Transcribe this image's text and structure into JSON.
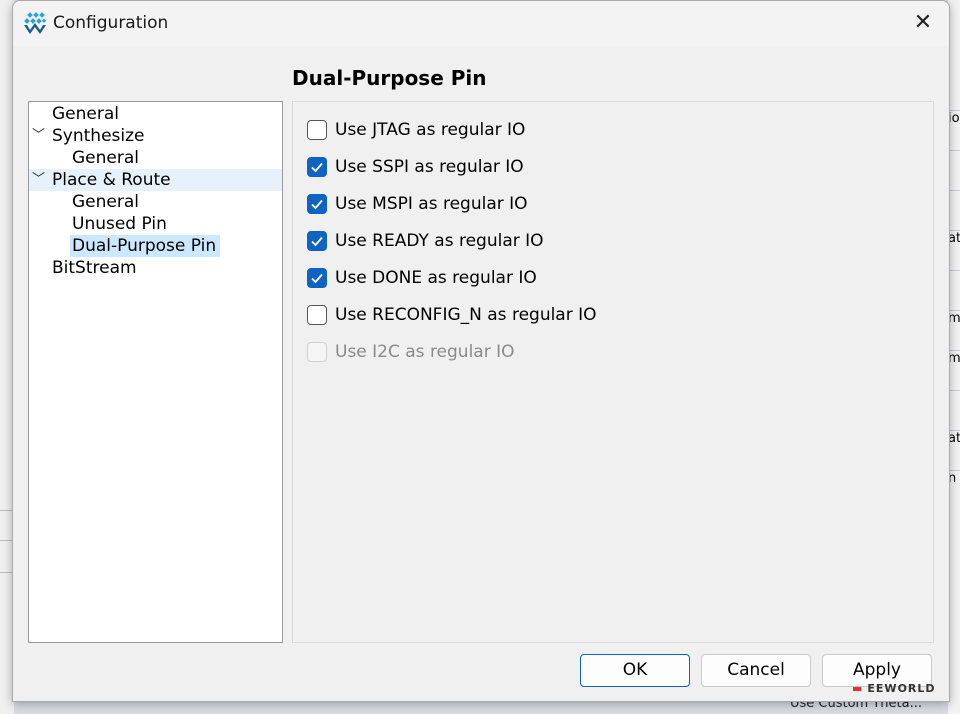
{
  "background": {
    "right_rows": [
      "io",
      "",
      "",
      "at",
      "",
      "mp",
      "m",
      "",
      "ate",
      "n"
    ],
    "bottom_text": "Use Custom Theta..."
  },
  "dialog": {
    "title": "Configuration",
    "close_icon": "close-icon",
    "section_title": "Dual-Purpose Pin",
    "tree": [
      {
        "label": "General",
        "level": 0,
        "expanded": null
      },
      {
        "label": "Synthesize",
        "level": 0,
        "expanded": true
      },
      {
        "label": "General",
        "level": 1
      },
      {
        "label": "Place & Route",
        "level": 0,
        "expanded": true,
        "hover": true
      },
      {
        "label": "General",
        "level": 1
      },
      {
        "label": "Unused Pin",
        "level": 1
      },
      {
        "label": "Dual-Purpose Pin",
        "level": 1,
        "selected": true
      },
      {
        "label": "BitStream",
        "level": 0
      }
    ],
    "options": [
      {
        "label": "Use JTAG as regular IO",
        "checked": false,
        "enabled": true
      },
      {
        "label": "Use SSPI as regular IO",
        "checked": true,
        "enabled": true
      },
      {
        "label": "Use MSPI as regular IO",
        "checked": true,
        "enabled": true
      },
      {
        "label": "Use READY as regular IO",
        "checked": true,
        "enabled": true
      },
      {
        "label": "Use DONE as regular IO",
        "checked": true,
        "enabled": true
      },
      {
        "label": "Use RECONFIG_N as regular IO",
        "checked": false,
        "enabled": true
      },
      {
        "label": "Use I2C as regular IO",
        "checked": false,
        "enabled": false
      }
    ],
    "buttons": {
      "ok": "OK",
      "cancel": "Cancel",
      "apply": "Apply"
    },
    "accent": "#0f63c3"
  },
  "watermark": "EEWORLD"
}
